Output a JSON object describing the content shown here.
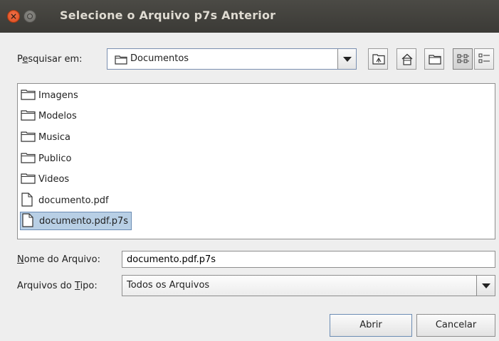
{
  "window": {
    "title": "Selecione o Arquivo p7s Anterior"
  },
  "lookin": {
    "label_pre": "P",
    "label_underlined": "e",
    "label_post": "squisar em:",
    "value": "Documentos"
  },
  "toolbar": {
    "buttons": [
      "up-one-level-icon",
      "home-icon",
      "new-folder-icon",
      "list-view-icon",
      "details-view-icon"
    ]
  },
  "files": [
    {
      "name": "Imagens",
      "type": "folder"
    },
    {
      "name": "Modelos",
      "type": "folder"
    },
    {
      "name": "Musica",
      "type": "folder"
    },
    {
      "name": "Publico",
      "type": "folder"
    },
    {
      "name": "Videos",
      "type": "folder"
    },
    {
      "name": "documento.pdf",
      "type": "file"
    },
    {
      "name": "documento.pdf.p7s",
      "type": "file",
      "selected": true
    }
  ],
  "filename": {
    "label_underlined": "N",
    "label_post": "ome do Arquivo:",
    "value": "documento.pdf.p7s"
  },
  "filetype": {
    "label_pre": "Arquivos do ",
    "label_underlined": "T",
    "label_post": "ipo:",
    "value": "Todos os Arquivos"
  },
  "actions": {
    "open_label": "Abrir",
    "cancel_label": "Cancelar"
  },
  "colors": {
    "selection": "#b8cfe5",
    "titlebar": "#3c3b37",
    "close": "#e8572a"
  }
}
